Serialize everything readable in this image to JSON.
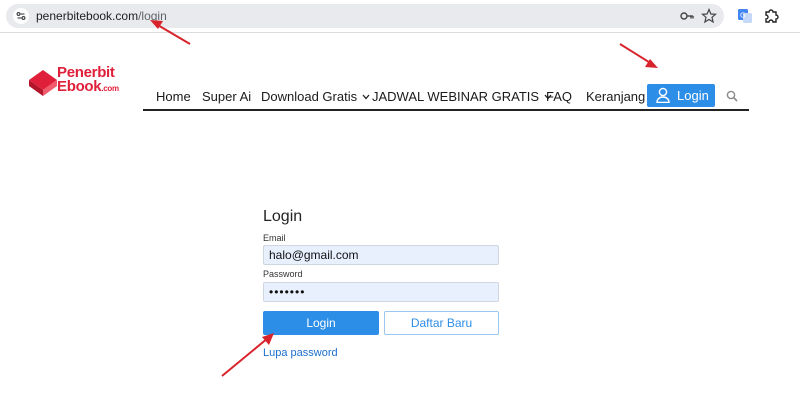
{
  "browser": {
    "url_host": "penerbitebook.com",
    "url_path": "/login",
    "icons": [
      "site-info-icon",
      "key-icon",
      "star-icon",
      "translate-icon",
      "extensions-icon"
    ]
  },
  "logo": {
    "line1": "Penerbit",
    "line2": "Ebook",
    "suffix": ".com"
  },
  "nav": {
    "items": [
      {
        "label": "Home"
      },
      {
        "label": "Super Ai"
      },
      {
        "label": "Download Gratis",
        "dropdown": true
      },
      {
        "label": "JADWAL WEBINAR GRATIS",
        "dropdown": true
      },
      {
        "label": "FAQ"
      },
      {
        "label": "Keranjang"
      }
    ],
    "login_label": "Login",
    "search_icon": "search-icon"
  },
  "form": {
    "title": "Login",
    "email_label": "Email",
    "email_value": "halo@gmail.com",
    "password_label": "Password",
    "password_value": "•••••••",
    "login_button": "Login",
    "register_button": "Daftar Baru",
    "forgot_link": "Lupa password"
  },
  "colors": {
    "accent": "#2d8ee8",
    "brand": "#e0203a",
    "annotation_arrow": "#d9232b",
    "autofill_bg": "#e8f0fe"
  }
}
